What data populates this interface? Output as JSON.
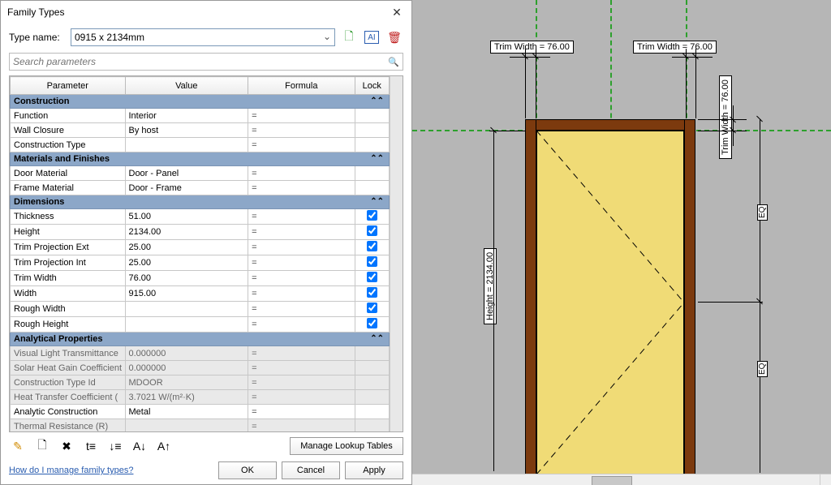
{
  "dialog": {
    "title": "Family Types",
    "type_label": "Type name:",
    "type_value": "0915 x 2134mm",
    "search_placeholder": "Search parameters",
    "columns": {
      "parameter": "Parameter",
      "value": "Value",
      "formula": "Formula",
      "lock": "Lock"
    },
    "groups": [
      {
        "name": "Construction",
        "rows": [
          {
            "param": "Function",
            "value": "Interior",
            "formula": "=",
            "lock": null
          },
          {
            "param": "Wall Closure",
            "value": "By host",
            "formula": "=",
            "lock": null
          },
          {
            "param": "Construction Type",
            "value": "",
            "formula": "=",
            "lock": null
          }
        ]
      },
      {
        "name": "Materials and Finishes",
        "rows": [
          {
            "param": "Door Material",
            "value": "Door - Panel",
            "formula": "=",
            "lock": null
          },
          {
            "param": "Frame Material",
            "value": "Door - Frame",
            "formula": "=",
            "lock": null
          }
        ]
      },
      {
        "name": "Dimensions",
        "rows": [
          {
            "param": "Thickness",
            "value": "51.00",
            "formula": "=",
            "lock": true
          },
          {
            "param": "Height",
            "value": "2134.00",
            "formula": "=",
            "lock": true
          },
          {
            "param": "Trim Projection Ext",
            "value": "25.00",
            "formula": "=",
            "lock": true
          },
          {
            "param": "Trim Projection Int",
            "value": "25.00",
            "formula": "=",
            "lock": true
          },
          {
            "param": "Trim Width",
            "value": "76.00",
            "formula": "=",
            "lock": true
          },
          {
            "param": "Width",
            "value": "915.00",
            "formula": "=",
            "lock": true
          },
          {
            "param": "Rough Width",
            "value": "",
            "formula": "=",
            "lock": true
          },
          {
            "param": "Rough Height",
            "value": "",
            "formula": "=",
            "lock": true
          }
        ]
      },
      {
        "name": "Analytical Properties",
        "rows": [
          {
            "param": "Visual Light Transmittance",
            "value": "0.000000",
            "formula": "=",
            "lock": null,
            "shaded": true
          },
          {
            "param": "Solar Heat Gain Coefficient",
            "value": "0.000000",
            "formula": "=",
            "lock": null,
            "shaded": true
          },
          {
            "param": "Construction Type Id",
            "value": "MDOOR",
            "formula": "=",
            "lock": null,
            "shaded": true
          },
          {
            "param": "Heat Transfer Coefficient (",
            "value": "3.7021 W/(m²·K)",
            "formula": "=",
            "lock": null,
            "shaded": true
          },
          {
            "param": "Analytic Construction",
            "value": "Metal",
            "formula": "=",
            "lock": null
          },
          {
            "param": "Thermal Resistance (R)",
            "value": "",
            "formula": "=",
            "lock": null,
            "shaded": true
          }
        ]
      }
    ],
    "manage_lookup": "Manage Lookup Tables",
    "help_link": "How do I manage family types?",
    "actions": {
      "ok": "OK",
      "cancel": "Cancel",
      "apply": "Apply"
    }
  },
  "viewport": {
    "trim_width_label_left": "Trim Width = 76.00",
    "trim_width_label_right": "Trim Width = 76.00",
    "trim_width_side": "Trim Width = 76.00",
    "height_label": "Height = 2134.00",
    "eq_top": "EQ",
    "eq_bottom": "EQ"
  }
}
